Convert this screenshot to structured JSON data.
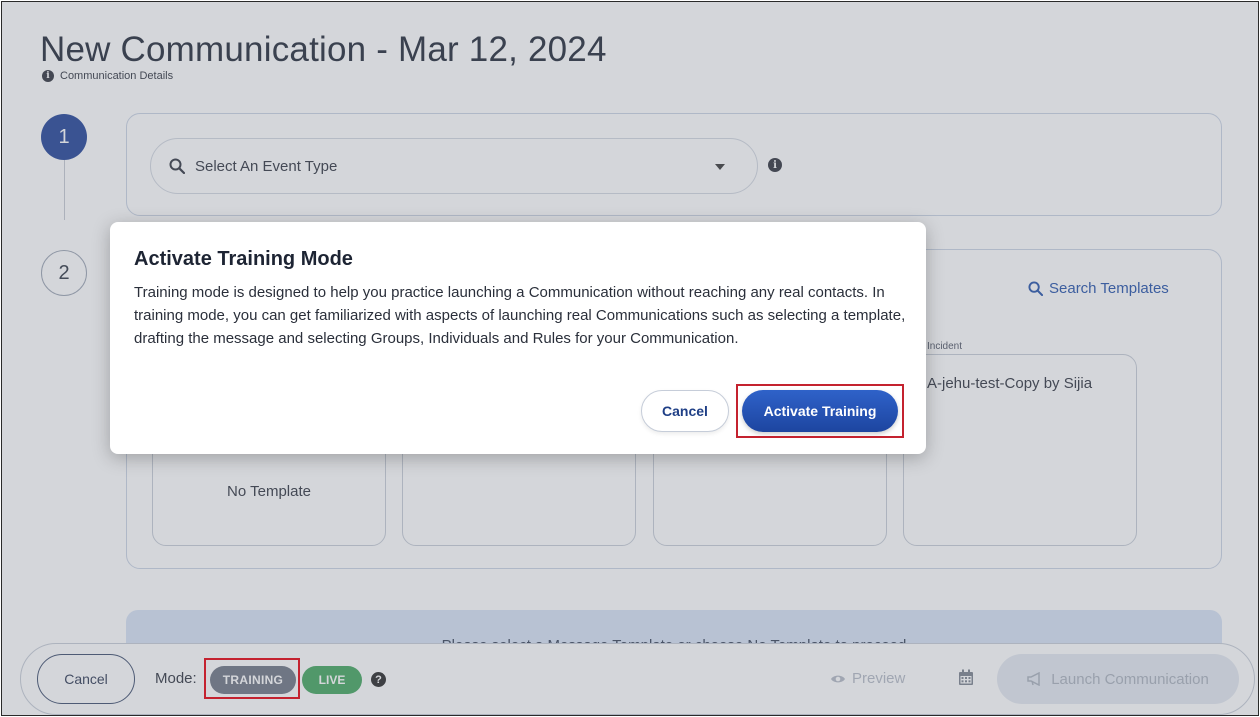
{
  "page": {
    "title": "New Communication - Mar 12, 2024",
    "subtitle": "Communication Details"
  },
  "steps": [
    {
      "number": "1",
      "state": "active"
    },
    {
      "number": "2",
      "state": "inactive"
    }
  ],
  "event_type": {
    "placeholder": "Select An Event Type"
  },
  "templates": {
    "search_label": "Search Templates",
    "items": [
      {
        "label": "No Template"
      },
      {
        "label": ""
      },
      {
        "label": ""
      },
      {
        "category": "Incident",
        "label": "A-jehu-test-Copy by Sijia"
      }
    ],
    "hint": "Please select a Message Template or choose No Template to proceed"
  },
  "bottom_bar": {
    "cancel_label": "Cancel",
    "mode_label": "Mode:",
    "mode_options": [
      "TRAINING",
      "LIVE"
    ],
    "preview_label": "Preview",
    "launch_label": "Launch Communication"
  },
  "modal": {
    "title": "Activate Training Mode",
    "body": "Training mode is designed to help you practice launching a Communication without reaching any real contacts. In training mode, you can get familiarized with aspects of launching real Communications such as selecting a template, drafting the message and selecting Groups, Individuals and Rules for your Communication.",
    "cancel_label": "Cancel",
    "activate_label": "Activate Training"
  },
  "colors": {
    "primary": "#1c3f96",
    "training_pill": "#6b7280",
    "live_pill": "#3ea45a",
    "highlight": "#c4222f"
  }
}
